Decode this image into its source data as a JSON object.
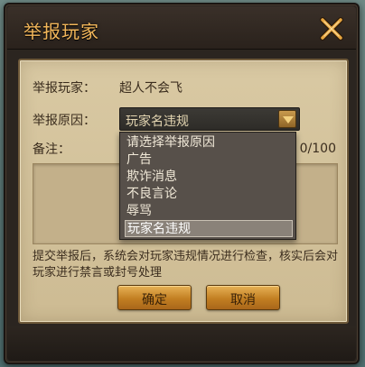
{
  "dialog": {
    "title": "举报玩家"
  },
  "form": {
    "player_label": "举报玩家：",
    "player_name": "超人不会飞",
    "reason_label": "举报原因：",
    "reason_selected": "玩家名违规",
    "notes_label": "备注：",
    "notes_counter": "0/100",
    "notes_value": ""
  },
  "dropdown": {
    "options": [
      "请选择举报原因",
      "广告",
      "欺诈消息",
      "不良言论",
      "辱骂",
      "玩家名违规"
    ],
    "selected_index": 5
  },
  "notice": {
    "text": "提交举报后，系统会对玩家违规情况进行检查，核实后会对玩家进行禁言或封号处理"
  },
  "buttons": {
    "confirm": "确定",
    "cancel": "取消"
  },
  "colors": {
    "title": "#f2b65a",
    "button": "#c27f22",
    "parchment": "#d9c9a3"
  }
}
